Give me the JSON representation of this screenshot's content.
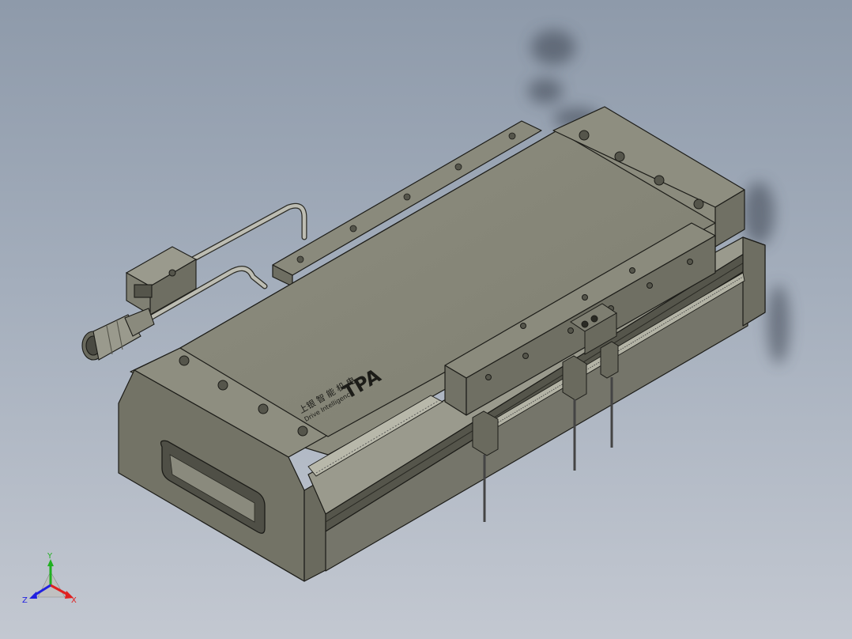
{
  "logo": {
    "brand_mark": "TPA",
    "company_line": "上银 智 能 机 电",
    "tagline": "Drive Intelligence"
  },
  "triad": {
    "x_label": "X",
    "y_label": "Y",
    "z_label": "Z",
    "x_color": "#e02020",
    "y_color": "#20b020",
    "z_color": "#2020e0"
  },
  "colors": {
    "body": "#7c7c6e",
    "body_light": "#8f8f81",
    "body_dark": "#5e5e52",
    "edge": "#1c1c18"
  }
}
